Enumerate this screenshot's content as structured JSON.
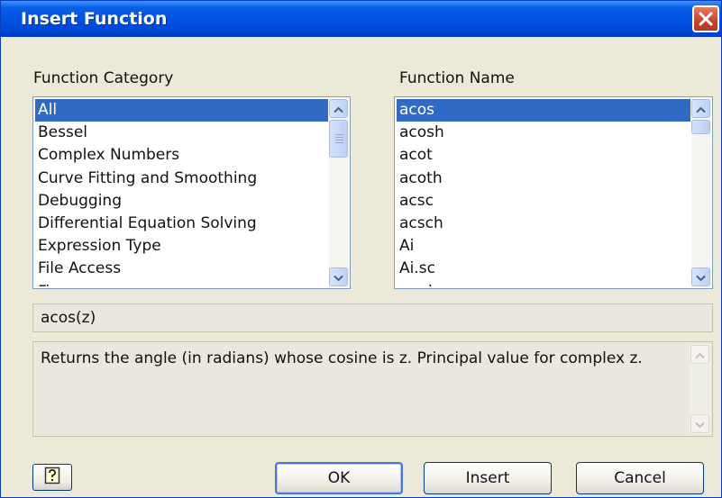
{
  "window": {
    "title": "Insert Function",
    "close_icon": "close-icon"
  },
  "category": {
    "label": "Function Category",
    "items": [
      "All",
      "Bessel",
      "Complex Numbers",
      "Curve Fitting and Smoothing",
      "Debugging",
      "Differential Equation Solving",
      "Expression Type",
      "File Access",
      "Finance"
    ],
    "selected": "All"
  },
  "name": {
    "label": "Function Name",
    "items": [
      "acos",
      "acosh",
      "acot",
      "acoth",
      "acsc",
      "acsch",
      "Ai",
      "Ai.sc",
      "angle"
    ],
    "selected": "acos"
  },
  "syntax": "acos(z)",
  "description": "Returns the angle (in radians) whose cosine is z. Principal value for complex z.",
  "buttons": {
    "help_icon": "help-icon",
    "ok": "OK",
    "insert": "Insert",
    "cancel": "Cancel"
  },
  "colors": {
    "title_bar": "#0054e3",
    "selection": "#316ac5",
    "close_button": "#c6412c",
    "dialog_bg": "#ece9d8"
  }
}
